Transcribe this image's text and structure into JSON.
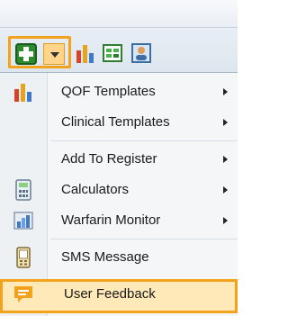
{
  "toolbar": {
    "add_icon": "add-green-plus-icon",
    "dropdown_icon": "dropdown-arrow-icon",
    "icons": [
      "bar-chart-icon",
      "template-grid-icon",
      "contact-card-icon"
    ]
  },
  "menu": {
    "items": [
      {
        "label": "QOF Templates",
        "icon": "bar-chart-icon",
        "has_submenu": true
      },
      {
        "label": "Clinical Templates",
        "icon": "",
        "has_submenu": true
      },
      {
        "label": "Add To Register",
        "icon": "",
        "has_submenu": true
      },
      {
        "label": "Calculators",
        "icon": "calculator-icon",
        "has_submenu": true
      },
      {
        "label": "Warfarin Monitor",
        "icon": "warfarin-chart-icon",
        "has_submenu": true
      },
      {
        "label": "SMS Message",
        "icon": "sms-phone-icon",
        "has_submenu": false
      },
      {
        "label": "User Feedback",
        "icon": "feedback-speech-bubble-icon",
        "has_submenu": false,
        "highlighted": true
      }
    ]
  },
  "colors": {
    "highlight_border": "#f3a21b",
    "highlight_fill": "#ffe9b8",
    "add_green": "#2e8a2e"
  }
}
